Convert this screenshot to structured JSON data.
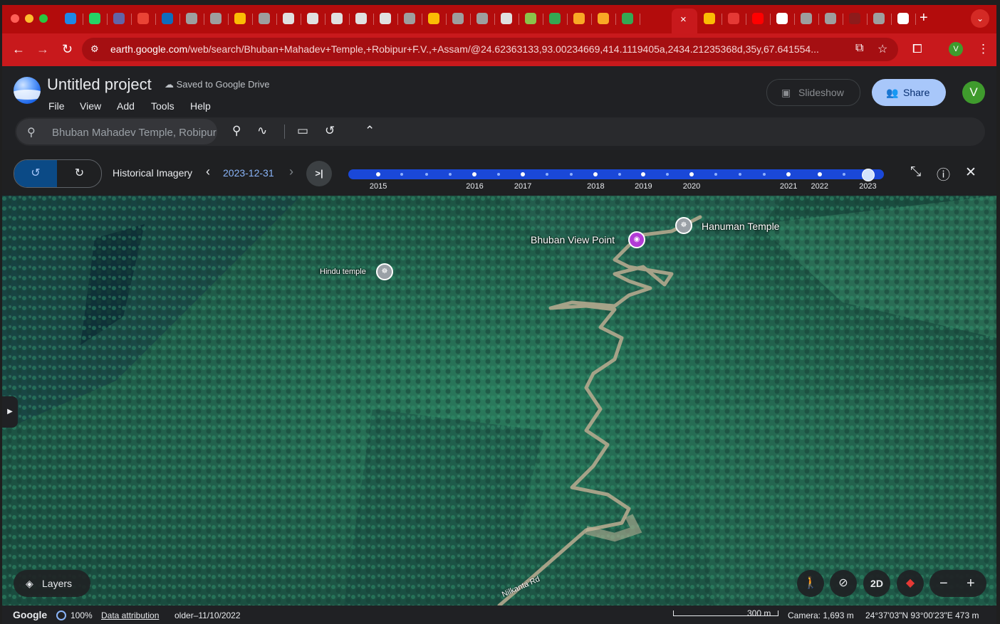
{
  "browser": {
    "tab_icons": [
      {
        "icon": "onedrive-icon",
        "color": "#1e88e5"
      },
      {
        "icon": "whatsapp-icon",
        "color": "#25d366"
      },
      {
        "icon": "teams-icon",
        "color": "#6264a7"
      },
      {
        "icon": "gmail-icon",
        "color": "#ea4335"
      },
      {
        "icon": "outlook-icon",
        "color": "#0f6cbd"
      },
      {
        "icon": "page-icon",
        "color": "#9e9e9e"
      },
      {
        "icon": "page-icon",
        "color": "#9e9e9e"
      },
      {
        "icon": "photos-icon",
        "color": "#fbbc04"
      },
      {
        "icon": "page-icon",
        "color": "#9e9e9e"
      },
      {
        "icon": "doc-icon",
        "color": "#e0e0e0"
      },
      {
        "icon": "doc-icon",
        "color": "#e0e0e0"
      },
      {
        "icon": "doc-icon",
        "color": "#e0e0e0"
      },
      {
        "icon": "doc-icon",
        "color": "#e0e0e0"
      },
      {
        "icon": "doc-icon",
        "color": "#e0e0e0"
      },
      {
        "icon": "page-icon",
        "color": "#9e9e9e"
      },
      {
        "icon": "photos-icon",
        "color": "#fbbc04"
      },
      {
        "icon": "page-icon",
        "color": "#9e9e9e"
      },
      {
        "icon": "page-icon",
        "color": "#9e9e9e"
      },
      {
        "icon": "doc-icon",
        "color": "#e0e0e0"
      },
      {
        "icon": "image-icon",
        "color": "#8bc34a"
      },
      {
        "icon": "maps-icon",
        "color": "#34a853"
      },
      {
        "icon": "emblem-icon",
        "color": "#f9a825"
      },
      {
        "icon": "emblem-icon",
        "color": "#f9a825"
      },
      {
        "icon": "maps-icon",
        "color": "#34a853"
      }
    ],
    "tab_icons_right": [
      {
        "icon": "maps-icon",
        "color": "#fbbc04"
      },
      {
        "icon": "toi-icon",
        "color": "#e53935"
      },
      {
        "icon": "youtube-icon",
        "color": "#ff0000"
      },
      {
        "icon": "google-icon",
        "color": "#ffffff"
      },
      {
        "icon": "page-icon",
        "color": "#9e9e9e"
      },
      {
        "icon": "page-icon",
        "color": "#9e9e9e"
      },
      {
        "icon": "emblem-icon",
        "color": "#8d1b1b"
      },
      {
        "icon": "page-icon",
        "color": "#9e9e9e"
      },
      {
        "icon": "google-icon",
        "color": "#ffffff"
      }
    ],
    "active_tab_close": "×",
    "new_tab": "+",
    "tab_menu": "⌄",
    "url_host": "earth.google.com",
    "url_path": "/web/search/Bhuban+Mahadev+Temple,+Robipur+F.V.,+Assam/@24.62363133,93.00234669,414.1119405a,2434.21235368d,35y,67.641554...",
    "profile_initial": "V"
  },
  "earth": {
    "project_title": "Untitled project",
    "saved_status": "Saved to Google Drive",
    "menu": [
      "File",
      "View",
      "Add",
      "Tools",
      "Help"
    ],
    "slideshow_label": "Slideshow",
    "share_label": "Share",
    "avatar_initial": "V",
    "search_value": "Bhuban Mahadev Temple, Robipur F.V., Assam",
    "historical": {
      "label": "Historical Imagery",
      "date": "2023-12-31",
      "years": [
        {
          "label": "2015",
          "pos": 0.056
        },
        {
          "label": "2016",
          "pos": 0.236
        },
        {
          "label": "2017",
          "pos": 0.326
        },
        {
          "label": "2018",
          "pos": 0.462
        },
        {
          "label": "2019",
          "pos": 0.551
        },
        {
          "label": "2020",
          "pos": 0.641
        },
        {
          "label": "2021",
          "pos": 0.822
        },
        {
          "label": "2022",
          "pos": 0.88
        },
        {
          "label": "2023",
          "pos": 0.97
        }
      ],
      "minor_positions": [
        0.1,
        0.146,
        0.19,
        0.281,
        0.371,
        0.416,
        0.507,
        0.596,
        0.686,
        0.732,
        0.777,
        0.925
      ],
      "selected_pos": 0.97
    },
    "places": {
      "hanuman": "Hanuman Temple",
      "viewpoint": "Bhuban View Point",
      "hindu": "Hindu temple",
      "road": "Nilkanta Rd"
    },
    "layers_label": "Layers",
    "mode_2d": "2D",
    "status": {
      "google": "Google",
      "zoom": "100%",
      "attribution": "Data attribution",
      "imagery_date": "older–11/10/2022",
      "scale": "300 m",
      "camera": "Camera: 1,693 m",
      "coords": "24°37'03\"N 93°00'23\"E 473 m"
    }
  }
}
